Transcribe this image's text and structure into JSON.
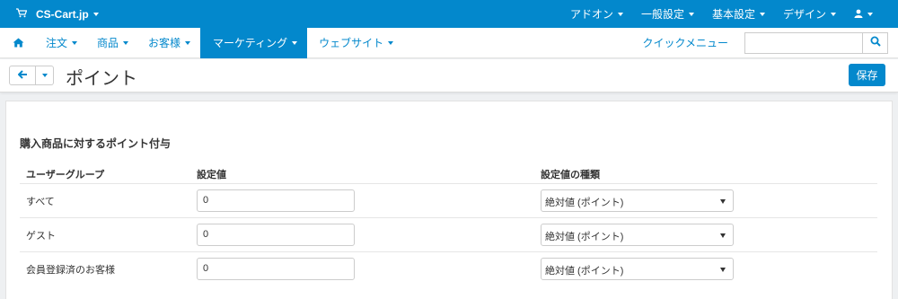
{
  "topbar": {
    "brand": "CS-Cart.jp",
    "menus": [
      "アドオン",
      "一般設定",
      "基本設定",
      "デザイン"
    ]
  },
  "nav": {
    "items": [
      "注文",
      "商品",
      "お客様",
      "マーケティング",
      "ウェブサイト"
    ],
    "active_index": 3,
    "quick_menu": "クイックメニュー",
    "search_value": ""
  },
  "title": {
    "page_title": "ポイント",
    "save_label": "保存"
  },
  "section": {
    "title": "購入商品に対するポイント付与",
    "columns": [
      "ユーザーグループ",
      "設定値",
      "設定値の種類"
    ],
    "rows": [
      {
        "group": "すべて",
        "value": "0",
        "type": "絶対値 (ポイント)"
      },
      {
        "group": "ゲスト",
        "value": "0",
        "type": "絶対値 (ポイント)"
      },
      {
        "group": "会員登録済のお客様",
        "value": "0",
        "type": "絶対値 (ポイント)"
      }
    ]
  },
  "colors": {
    "accent": "#0388cc"
  },
  "icons": {
    "cart": "cart-icon",
    "user": "user-icon",
    "home": "home-icon",
    "search": "search-icon",
    "back": "back-arrow-icon"
  }
}
